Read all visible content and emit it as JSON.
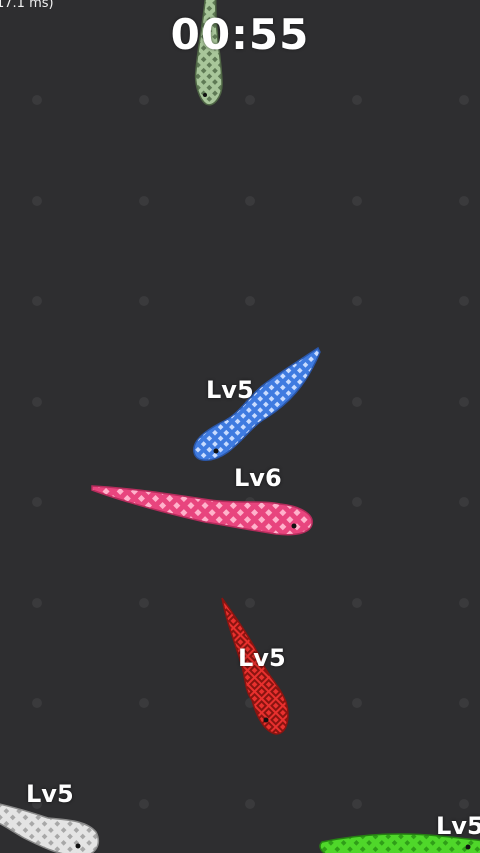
{
  "hud": {
    "timer": "00:55",
    "frame_time": "17.1 ms)"
  },
  "colors": {
    "background": "#2e2e30",
    "dot": "#3a3a3c"
  },
  "snakes": [
    {
      "id": "green-top",
      "color": "#a8c69a",
      "pattern": "#5f7a55",
      "label": ""
    },
    {
      "id": "blue",
      "color": "#3f7be0",
      "pattern": "#c9dcff",
      "label": "Lv5"
    },
    {
      "id": "pink",
      "color": "#e8457e",
      "pattern": "#ffb3cc",
      "label": "Lv6"
    },
    {
      "id": "red",
      "color": "#e8302e",
      "pattern": "#8a1410",
      "label": "Lv5"
    },
    {
      "id": "white",
      "color": "#e4e4e4",
      "pattern": "#a8a8a8",
      "label": "Lv5"
    },
    {
      "id": "lime",
      "color": "#4fd72a",
      "pattern": "#2f9e18",
      "label": "Lv5"
    }
  ]
}
